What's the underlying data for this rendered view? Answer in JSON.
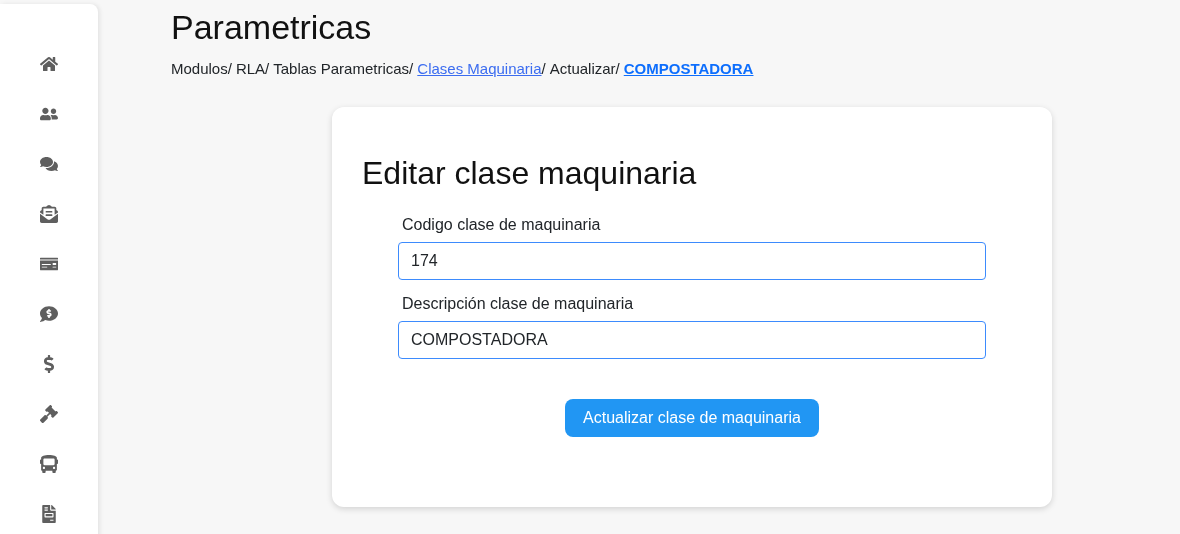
{
  "title": "Parametricas",
  "breadcrumb": [
    {
      "text": "Modulos/",
      "kind": "plain"
    },
    {
      "text": "RLA/",
      "kind": "plain"
    },
    {
      "text": "Tablas Parametricas/",
      "kind": "plain"
    },
    {
      "text": "Clases Maquinaria",
      "kind": "link"
    },
    {
      "text": "/",
      "kind": "plain"
    },
    {
      "text": "Actualizar/",
      "kind": "plain"
    },
    {
      "text": "COMPOSTADORA",
      "kind": "current"
    }
  ],
  "form": {
    "heading": "Editar clase maquinaria",
    "fields": [
      {
        "label": "Codigo clase de maquinaria",
        "value": "174"
      },
      {
        "label": "Descripción clase de maquinaria",
        "value": "COMPOSTADORA"
      }
    ],
    "submit": "Actualizar clase de maquinaria"
  }
}
